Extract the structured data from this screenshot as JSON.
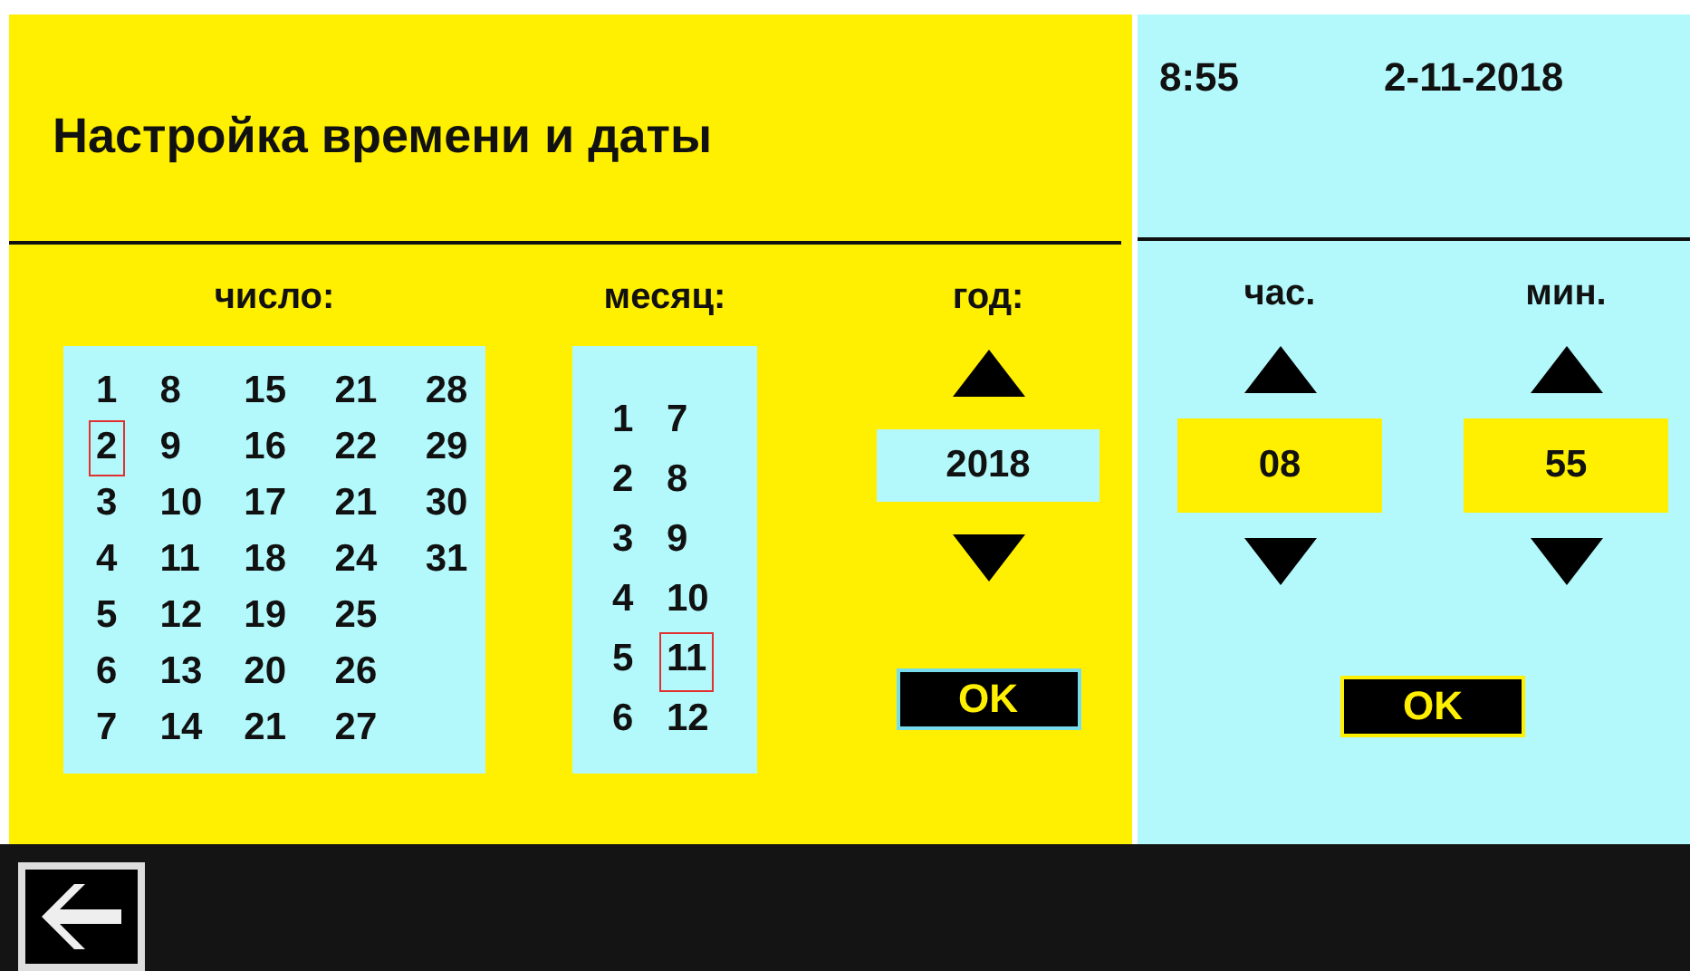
{
  "title": "Настройка времени и даты",
  "clock": {
    "time": "8:55",
    "date": "2-11-2018"
  },
  "day": {
    "label": "число:",
    "columns": [
      [
        {
          "label": "1",
          "selected": false
        },
        {
          "label": "2",
          "selected": true
        },
        {
          "label": "3",
          "selected": false
        },
        {
          "label": "4",
          "selected": false
        },
        {
          "label": "5",
          "selected": false
        },
        {
          "label": "6",
          "selected": false
        },
        {
          "label": "7",
          "selected": false
        }
      ],
      [
        {
          "label": "8",
          "selected": false
        },
        {
          "label": "9",
          "selected": false
        },
        {
          "label": "10",
          "selected": false
        },
        {
          "label": "11",
          "selected": false
        },
        {
          "label": "12",
          "selected": false
        },
        {
          "label": "13",
          "selected": false
        },
        {
          "label": "14",
          "selected": false
        }
      ],
      [
        {
          "label": "15",
          "selected": false
        },
        {
          "label": "16",
          "selected": false
        },
        {
          "label": "17",
          "selected": false
        },
        {
          "label": "18",
          "selected": false
        },
        {
          "label": "19",
          "selected": false
        },
        {
          "label": "20",
          "selected": false
        },
        {
          "label": "21",
          "selected": false
        }
      ],
      [
        {
          "label": "21",
          "selected": false
        },
        {
          "label": "22",
          "selected": false
        },
        {
          "label": "21",
          "selected": false
        },
        {
          "label": "24",
          "selected": false
        },
        {
          "label": "25",
          "selected": false
        },
        {
          "label": "26",
          "selected": false
        },
        {
          "label": "27",
          "selected": false
        }
      ],
      [
        {
          "label": "28",
          "selected": false
        },
        {
          "label": "29",
          "selected": false
        },
        {
          "label": "30",
          "selected": false
        },
        {
          "label": "31",
          "selected": false
        }
      ]
    ]
  },
  "month": {
    "label": "месяц:",
    "columns": [
      [
        {
          "label": "1",
          "selected": false
        },
        {
          "label": "2",
          "selected": false
        },
        {
          "label": "3",
          "selected": false
        },
        {
          "label": "4",
          "selected": false
        },
        {
          "label": "5",
          "selected": false
        },
        {
          "label": "6",
          "selected": false
        }
      ],
      [
        {
          "label": "7",
          "selected": false
        },
        {
          "label": "8",
          "selected": false
        },
        {
          "label": "9",
          "selected": false
        },
        {
          "label": "10",
          "selected": false
        },
        {
          "label": "11",
          "selected": true
        },
        {
          "label": "12",
          "selected": false
        }
      ]
    ]
  },
  "year": {
    "label": "год:",
    "value": "2018",
    "ok": "OK"
  },
  "hour": {
    "label": "час.",
    "value": "08"
  },
  "minute": {
    "label": "мин.",
    "value": "55"
  },
  "time_ok": "OK"
}
